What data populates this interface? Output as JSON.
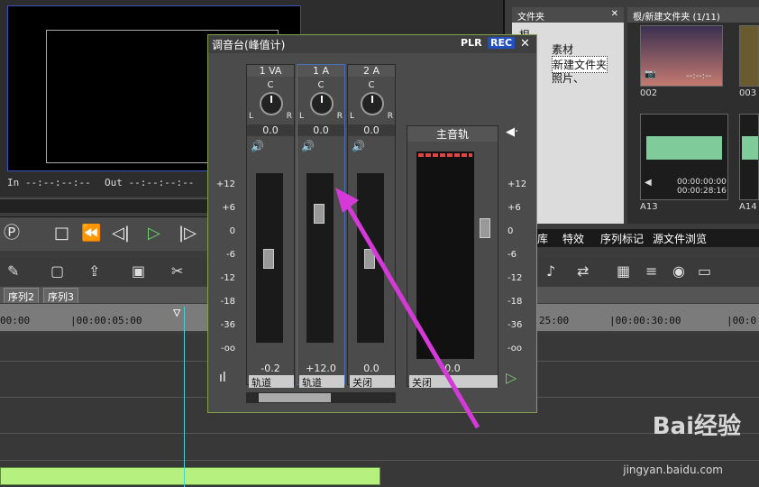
{
  "preview": {
    "in_timecode": "In --:--:--:--",
    "out_timecode": "Out --:--:--:--"
  },
  "sequence_tabs": [
    "序列2",
    "序列3"
  ],
  "ruler": [
    "00:00",
    "|00:00:05:00",
    "25:00",
    "|00:00:30:00",
    "|00:0"
  ],
  "folder_panel": {
    "title": "文件夹",
    "items": [
      "根",
      "素材",
      "新建文件夹",
      "照片、"
    ]
  },
  "bin_panel": {
    "title": "根/新建文件夹 (1/11)",
    "thumbs": [
      {
        "label": "002",
        "tc": "--:--:--"
      },
      {
        "label": "003",
        "tc": ""
      },
      {
        "label": "A13",
        "tc": "00:00:00:00\n00:00:28:16"
      },
      {
        "label": "A14",
        "tc": ""
      }
    ]
  },
  "right_tabs": [
    "库",
    "特效",
    "序列标记",
    "源文件浏览"
  ],
  "mixer": {
    "title": "调音台(峰值计)",
    "plr": "PLR",
    "rec": "REC",
    "channels": [
      {
        "name": "1 VA",
        "pan_label": "C",
        "pan_value": "0.0",
        "level": "-0.2",
        "output": "轨道"
      },
      {
        "name": "1 A",
        "pan_label": "C",
        "pan_value": "0.0",
        "level": "+12.0",
        "output": "轨道"
      },
      {
        "name": "2 A",
        "pan_label": "C",
        "pan_value": "0.0",
        "level": "0.0",
        "output": "关闭"
      }
    ],
    "master": {
      "name": "主音轨",
      "level": "0.0",
      "output": "关闭"
    },
    "scale": [
      "+12",
      "+6",
      "0",
      "-6",
      "-12",
      "-18",
      "-36",
      "-oo"
    ]
  },
  "watermark": {
    "brand": "Bai经验",
    "url": "jingyan.baidu.com"
  }
}
